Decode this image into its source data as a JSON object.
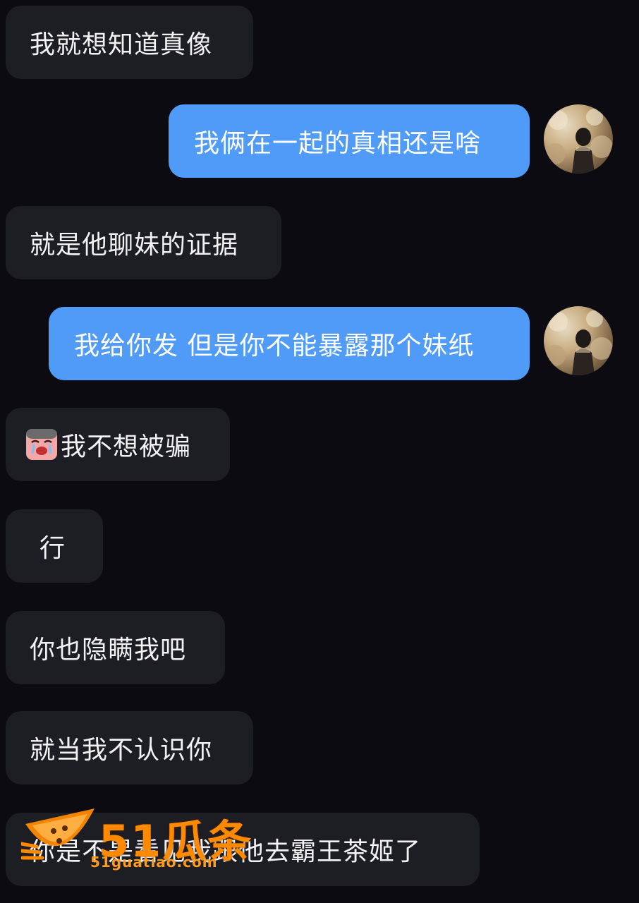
{
  "messages": [
    {
      "side": "incoming",
      "text": "我就想知道真像"
    },
    {
      "side": "outgoing",
      "text": "我俩在一起的真相还是啥"
    },
    {
      "side": "incoming",
      "text": "就是他聊妹的证据"
    },
    {
      "side": "outgoing",
      "text": "我给你发 但是你不能暴露那个妹纸"
    },
    {
      "side": "incoming",
      "text": "我不想被骗",
      "emoji": "crying-face-sticker"
    },
    {
      "side": "incoming",
      "text": "行"
    },
    {
      "side": "incoming",
      "text": "你也隐瞒我吧"
    },
    {
      "side": "incoming",
      "text": "就当我不认识你"
    },
    {
      "side": "incoming",
      "text": "你是不是看见我跟他去霸王茶姬了"
    }
  ],
  "watermark": {
    "brand": "51瓜条",
    "url": "51guatiao.com",
    "icon": "watermelon-slice-icon",
    "color": "#ff8a00"
  },
  "colors": {
    "background": "#0b0b11",
    "incoming_bubble": "#1d1d24",
    "outgoing_bubble": "#4f9bf7"
  }
}
